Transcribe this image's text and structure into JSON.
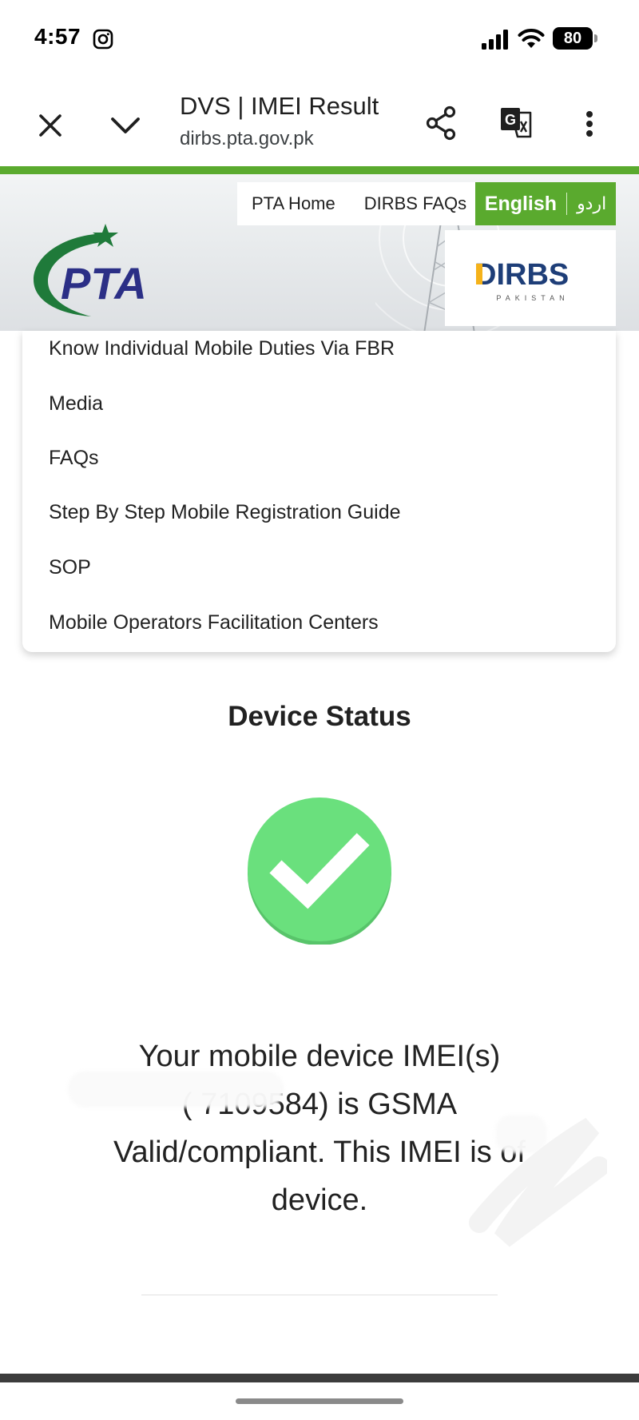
{
  "status_bar": {
    "time": "4:57",
    "battery": "80",
    "icons": [
      "instagram-icon",
      "signal-icon",
      "wifi-icon",
      "battery-icon"
    ]
  },
  "browser": {
    "title": "DVS | IMEI Result",
    "url": "dirbs.pta.gov.pk",
    "icons": [
      "close-icon",
      "chevron-down-icon",
      "share-icon",
      "translate-icon",
      "more-vert-icon"
    ]
  },
  "header": {
    "links": [
      "PTA Home",
      "DIRBS FAQs"
    ],
    "lang_en": "English",
    "lang_ur": "اردو",
    "pta_logo_text": "PTA",
    "dirbs_logo_text": "DIRBS",
    "dirbs_subtext": "PAKISTAN",
    "accent_color": "#5aaa2e"
  },
  "menu": {
    "items": [
      "Know Individual Mobile Duties Via FBR",
      "Media",
      "FAQs",
      "Step By Step Mobile Registration Guide",
      "SOP",
      "Mobile Operators Facilitation Centers"
    ]
  },
  "device_status": {
    "heading": "Device Status",
    "status_color": "#6ae07d",
    "message_lines": [
      "Your mobile device IMEI(s)",
      "(           7109584) is GSMA",
      "Valid/compliant. This IMEI is of",
      "device."
    ]
  }
}
